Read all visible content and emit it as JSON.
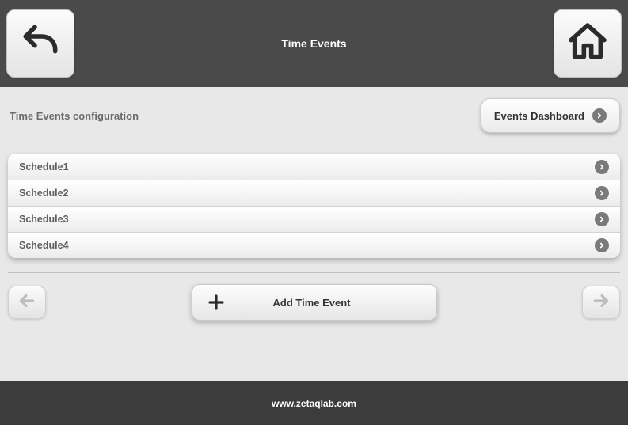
{
  "header": {
    "title": "Time Events"
  },
  "sub": {
    "title": "Time Events configuration",
    "dashboard_label": "Events Dashboard"
  },
  "schedules": [
    {
      "label": "Schedule1"
    },
    {
      "label": "Schedule2"
    },
    {
      "label": "Schedule3"
    },
    {
      "label": "Schedule4"
    }
  ],
  "actions": {
    "add_label": "Add Time Event"
  },
  "footer": {
    "text": "www.zetaqlab.com"
  }
}
